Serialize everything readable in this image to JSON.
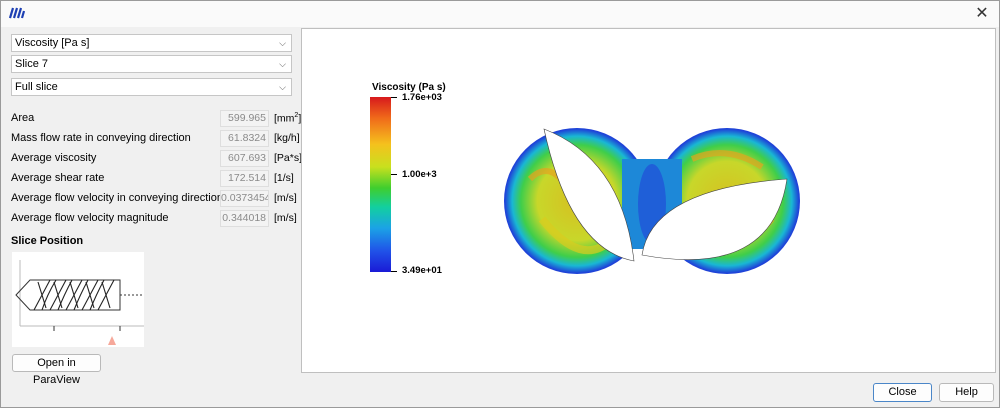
{
  "window": {
    "title": ""
  },
  "left": {
    "dropdowns": [
      {
        "value": "Viscosity [Pa s]"
      },
      {
        "value": "Slice 7"
      },
      {
        "value": "Full slice"
      }
    ],
    "stats": [
      {
        "label": "Area",
        "value": "599.965",
        "unit_pre": "[mm",
        "unit_sup": "2",
        "unit_post": "]"
      },
      {
        "label": "Mass flow rate in conveying direction",
        "value": "61.8324",
        "unit": "[kg/h]"
      },
      {
        "label": "Average viscosity",
        "value": "607.693",
        "unit": "[Pa*s]"
      },
      {
        "label": "Average shear rate",
        "value": "172.514",
        "unit": "[1/s]"
      },
      {
        "label": "Average flow velocity in conveying direction",
        "value": "0.0373454",
        "unit": "[m/s]"
      },
      {
        "label": "Average flow velocity magnitude",
        "value": "0.344018",
        "unit": "[m/s]"
      }
    ],
    "slice_title": "Slice Position",
    "open_button": "Open in ParaView"
  },
  "viewport": {
    "legend_title": "Viscosity (Pa s)",
    "legend_max": "1.76e+03",
    "legend_mid": "1.00e+3",
    "legend_min": "3.49e+01",
    "colors": {
      "max": "#d7191c",
      "mid": "#3fce2e",
      "min": "#1a1ad6"
    }
  },
  "footer": {
    "close": "Close",
    "help": "Help"
  },
  "icons": {
    "app": "app-logo-icon",
    "close": "close-icon",
    "chevron": "chevron-down-icon"
  }
}
